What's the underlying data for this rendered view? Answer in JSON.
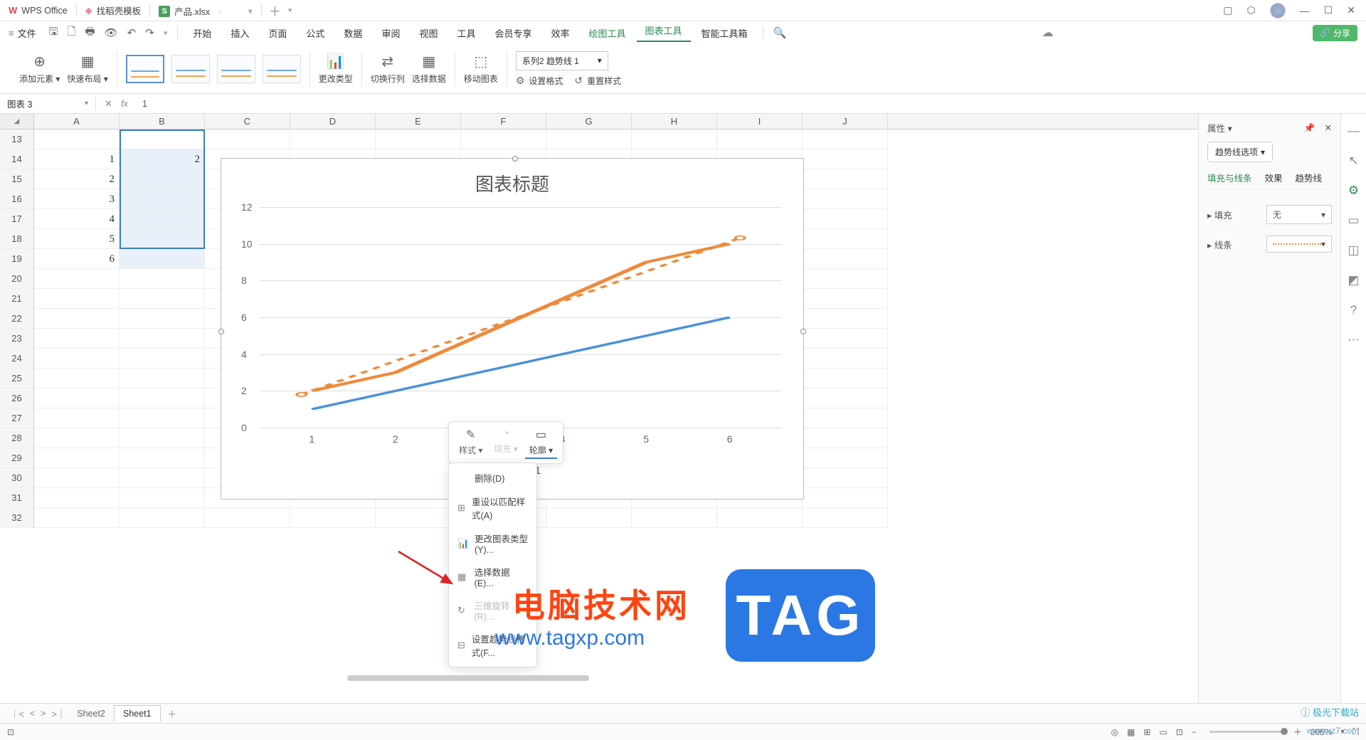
{
  "titlebar": {
    "tabs": [
      {
        "icon": "W",
        "label": "WPS Office"
      },
      {
        "icon": "D",
        "label": "找稻壳模板"
      },
      {
        "icon": "S",
        "label": "产品.xlsx",
        "active": true
      }
    ]
  },
  "menubar": {
    "file_label": "文件",
    "items": [
      "开始",
      "插入",
      "页面",
      "公式",
      "数据",
      "审阅",
      "视图",
      "工具",
      "会员专享",
      "效率"
    ],
    "green_items": [
      "绘图工具",
      "图表工具"
    ],
    "active": "图表工具",
    "extra": [
      "智能工具箱"
    ],
    "share_label": "分享"
  },
  "ribbon": {
    "add_element": "添加元素",
    "quick_layout": "快速布局",
    "change_type": "更改类型",
    "switch_rowcol": "切换行列",
    "select_data": "选择数据",
    "move_chart": "移动图表",
    "dropdown_value": "系列2 趋势线 1",
    "format_btn": "设置格式",
    "reset_btn": "重置样式"
  },
  "formulabar": {
    "name": "图表 3",
    "fx": "fx",
    "value": "1"
  },
  "columns": [
    "A",
    "B",
    "C",
    "D",
    "E",
    "F",
    "G",
    "H",
    "I",
    "J"
  ],
  "rows": [
    "13",
    "14",
    "15",
    "16",
    "17",
    "18",
    "19",
    "20",
    "21",
    "22",
    "23",
    "24",
    "25",
    "26",
    "27",
    "28",
    "29",
    "30",
    "31",
    "32"
  ],
  "cell_data": {
    "A14": "1",
    "B14": "2",
    "A15": "2",
    "A16": "3",
    "A17": "4",
    "A18": "5",
    "A19": "6"
  },
  "chart_data": {
    "type": "line",
    "title": "图表标题",
    "categories": [
      "1",
      "2",
      "3",
      "4",
      "5",
      "6"
    ],
    "series": [
      {
        "name": "系列1",
        "color": "#4a90d9",
        "values": [
          1,
          2,
          3,
          4,
          5,
          6
        ]
      },
      {
        "name": "系列2",
        "color": "#ef8a3a",
        "values": [
          2,
          3,
          5,
          7,
          9,
          10
        ]
      }
    ],
    "trendline": {
      "for": "系列2",
      "style": "dotted",
      "color": "#ef8a3a"
    },
    "ylim": [
      0,
      12
    ],
    "ytick": 2,
    "xlabel": "",
    "ylabel": ""
  },
  "mini_toolbar": {
    "style": "样式",
    "fill": "填充",
    "outline": "轮廓"
  },
  "context_menu": {
    "items": [
      {
        "label": "删除(D)",
        "icon": ""
      },
      {
        "label": "重设以匹配样式(A)",
        "icon": "⊞"
      },
      {
        "label": "更改图表类型(Y)...",
        "icon": "📊"
      },
      {
        "label": "选择数据(E)...",
        "icon": "▦"
      },
      {
        "label": "三维旋转(R)...",
        "icon": "↻",
        "disabled": true
      },
      {
        "label": "设置趋势线格式(F...",
        "icon": "⊟"
      }
    ]
  },
  "right_panel": {
    "title": "属性",
    "dropdown": "趋势线选项",
    "tabs": [
      "填充与线条",
      "效果",
      "趋势线"
    ],
    "active_tab": "填充与线条",
    "fill_label": "填充",
    "fill_value": "无",
    "line_label": "线条"
  },
  "sheet_tabs": {
    "sheets": [
      "Sheet2",
      "Sheet1"
    ],
    "active": "Sheet1"
  },
  "statusbar": {
    "zoom": "205%",
    "mode": "⊞"
  },
  "watermarks": {
    "cn": "电脑技术网",
    "url": "www.tagxp.com",
    "tag": "TAG",
    "jg": "极光下载站",
    "xzl": "www.xz7.com"
  },
  "colors": {
    "accent": "#2e8b4f",
    "series1": "#4a90d9",
    "series2": "#ef8a3a",
    "selection": "#3a7fc4",
    "tag_bg": "#2b78e4"
  }
}
